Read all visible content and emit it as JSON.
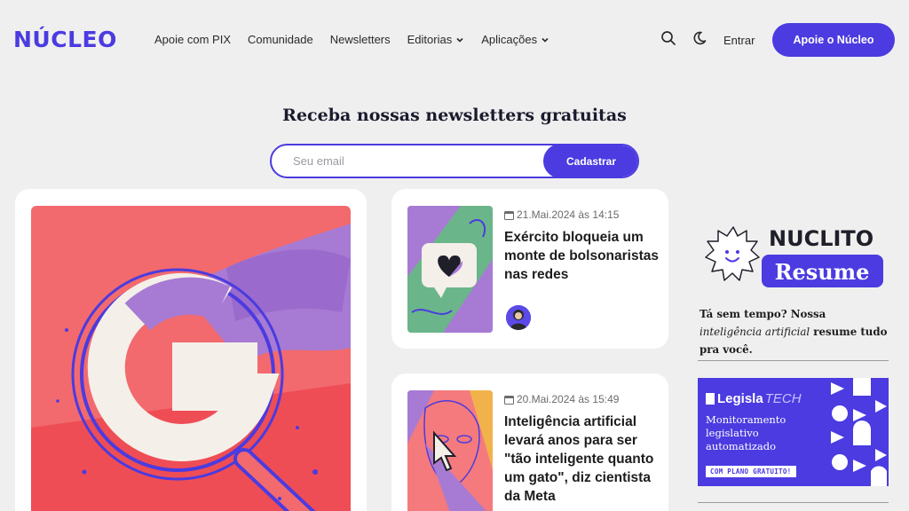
{
  "header": {
    "logo": "NÚCLEO",
    "nav": [
      {
        "label": "Apoie com PIX",
        "dropdown": false
      },
      {
        "label": "Comunidade",
        "dropdown": false
      },
      {
        "label": "Newsletters",
        "dropdown": false
      },
      {
        "label": "Editorias",
        "dropdown": true
      },
      {
        "label": "Aplicações",
        "dropdown": true
      }
    ],
    "icons": [
      "search-icon",
      "moon-icon"
    ],
    "login_label": "Entrar",
    "support_label": "Apoie o Núcleo"
  },
  "newsletter": {
    "title": "Receba nossas newsletters gratuitas",
    "email_placeholder": "Seu email",
    "submit_label": "Cadastrar"
  },
  "articles": [
    {
      "date": "21.Mai.2024 às 14:15",
      "title": "Exército bloqueia um monte de bolsonaristas nas redes"
    },
    {
      "date": "20.Mai.2024 às 15:49",
      "title": "Inteligência artificial levará anos para ser \"tão inteligente quanto um gato\", diz cientista da Meta"
    }
  ],
  "sidebar": {
    "nuclito": {
      "name": "NUCLITO",
      "badge": "Resume",
      "text_before": "Tá sem tempo? Nossa ",
      "text_em": "inteligência artificial",
      "text_after": " resume tudo pra você."
    },
    "legisla": {
      "brand_bold": "Legisla",
      "brand_italic": "TECH",
      "desc": "Monitoramento legislativo automatizado",
      "cta": "COM PLANO GRATUITO!"
    }
  },
  "colors": {
    "accent": "#4b3be0",
    "background": "#efefef",
    "card": "#ffffff"
  }
}
